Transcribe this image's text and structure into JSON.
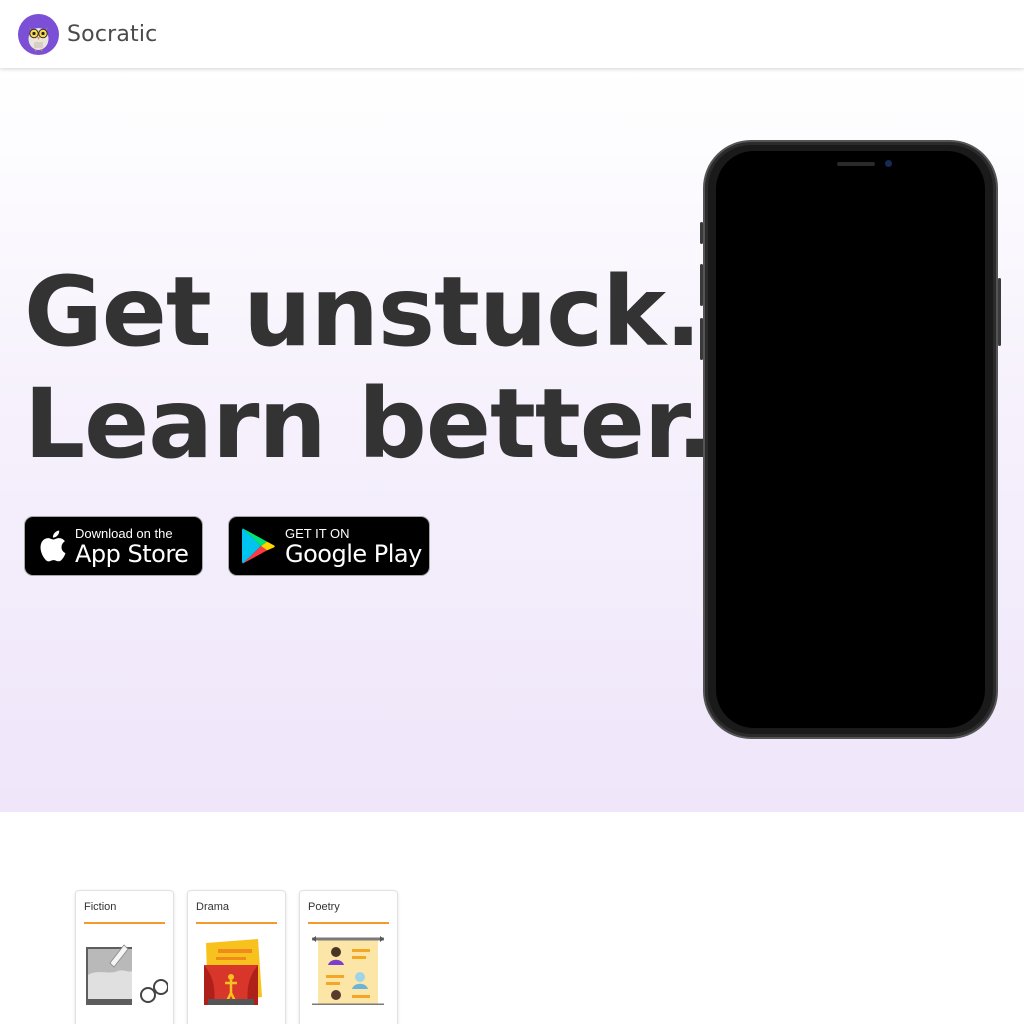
{
  "header": {
    "brand": "Socratic",
    "logo_icon": "owl-logo-icon",
    "logo_color": "#7b4fd6"
  },
  "hero": {
    "headline_line1": "Get unstuck.",
    "headline_line2": "Learn better.",
    "app_store": {
      "small_text": "Download on the",
      "large_text": "App Store",
      "icon": "apple-icon"
    },
    "google_play": {
      "small_text": "GET IT ON",
      "large_text": "Google Play",
      "icon": "google-play-icon"
    },
    "phone_image": "smartphone-mockup"
  },
  "subjects": {
    "cards": [
      {
        "label": "Fiction",
        "icon": "book-glasses-icon"
      },
      {
        "label": "Drama",
        "icon": "theater-stage-icon"
      },
      {
        "label": "Poetry",
        "icon": "scroll-portraits-icon"
      }
    ],
    "accent_color": "#f29a2e"
  }
}
